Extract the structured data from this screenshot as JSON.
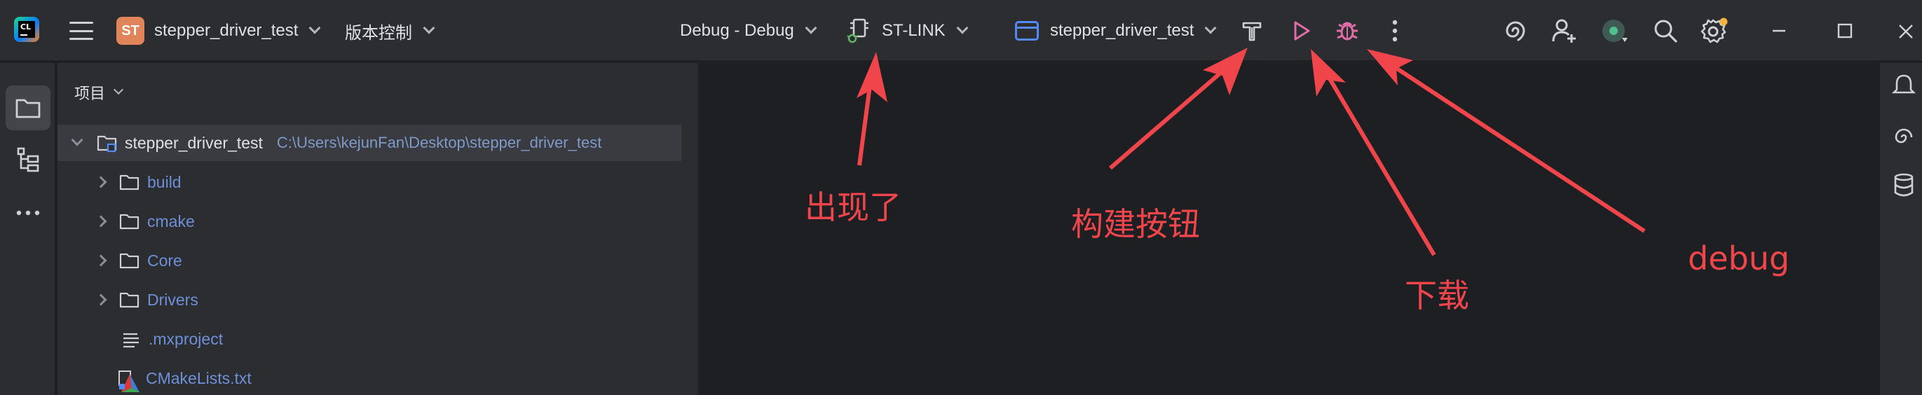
{
  "titlebar": {
    "app_logo_text": "CL",
    "project_badge": "ST",
    "project_name": "stepper_driver_test",
    "vcs_label": "版本控制",
    "build_config": "Debug - Debug",
    "debugger_label": "ST-LINK",
    "run_target": "stepper_driver_test",
    "icons": [
      "app-logo",
      "hamburger-menu-icon",
      "chevron-down-icon",
      "chip-icon",
      "window-icon",
      "build-hammer-icon",
      "run-play-icon",
      "debug-bug-icon",
      "more-vertical-icon",
      "ai-spiral-icon",
      "add-user-icon",
      "status-dot-icon",
      "search-icon",
      "settings-gear-icon",
      "minimize-icon",
      "maximize-icon",
      "close-icon"
    ]
  },
  "colors": {
    "accent_red": "#f0464b",
    "run_pink": "#e06ca8",
    "project_badge": "#e0855a",
    "window_blue": "#548af7"
  },
  "panel": {
    "title": "项目",
    "root": {
      "name": "stepper_driver_test",
      "path": "C:\\Users\\kejunFan\\Desktop\\stepper_driver_test"
    },
    "items": [
      {
        "name": "build",
        "type": "folder"
      },
      {
        "name": "cmake",
        "type": "folder"
      },
      {
        "name": "Core",
        "type": "folder"
      },
      {
        "name": "Drivers",
        "type": "folder"
      },
      {
        "name": ".mxproject",
        "type": "text-file"
      },
      {
        "name": "CMakeLists.txt",
        "type": "cmake-file"
      }
    ]
  },
  "annotations": {
    "appeared": "出现了",
    "build_button": "构建按钮",
    "download": "下载",
    "debug": "debug"
  }
}
